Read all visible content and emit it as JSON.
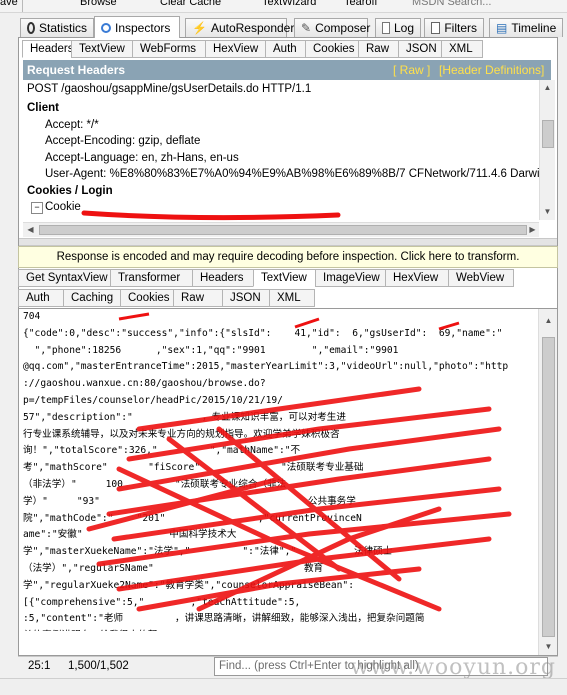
{
  "toolbar_top": {
    "items": [
      "ave",
      "Browse",
      "Clear Cache",
      "TextWizard",
      "Tearoff",
      "MSDN Search..."
    ]
  },
  "main_tabs": [
    {
      "label": "Statistics",
      "icon": "stopwatch-icon"
    },
    {
      "label": "Inspectors",
      "icon": "magnifier-icon",
      "active": true
    },
    {
      "label": "AutoResponder",
      "icon": "lightning-icon"
    },
    {
      "label": "Composer",
      "icon": "pencil-icon"
    },
    {
      "label": "Log",
      "icon": "log-icon"
    },
    {
      "label": "Filters",
      "icon": "checkbox-icon"
    },
    {
      "label": "Timeline",
      "icon": "timeline-icon"
    }
  ],
  "request_tabs": [
    "Headers",
    "TextView",
    "WebForms",
    "HexView",
    "Auth",
    "Cookies",
    "Raw",
    "JSON",
    "XML"
  ],
  "request_headers": {
    "title": "Request Headers",
    "raw_link": "[ Raw ]",
    "defs_link": "[Header Definitions]",
    "request_line": "POST /gaoshou/gsappMine/gsUserDetails.do HTTP/1.1",
    "groups": [
      {
        "name": "Client",
        "lines": [
          "Accept: */*",
          "Accept-Encoding: gzip, deflate",
          "Accept-Language: en, zh-Hans, en-us",
          "User-Agent: %E8%80%83%E7%A0%94%E9%AB%98%E6%89%8B/7 CFNetwork/711.4.6 Darwin/1"
        ]
      },
      {
        "name": "Cookies / Login",
        "lines": [
          "Cookie"
        ]
      }
    ]
  },
  "banner": "Response is encoded and may require decoding before inspection. Click here to transform.",
  "response_tabs_row1": [
    "Get SyntaxView",
    "Transformer",
    "Headers",
    "TextView",
    "ImageView",
    "HexView",
    "WebView"
  ],
  "response_tabs_row2": [
    "Auth",
    "Caching",
    "Cookies",
    "Raw",
    "JSON",
    "XML"
  ],
  "response_text": [
    "704",
    "{\"code\":0,\"desc\":\"success\",\"info\":{\"slsId\":    41,\"id\":  6,\"gsUserId\":  69,\"name\":\"",
    "  \",\"phone\":18256      ,\"sex\":1,\"qq\":\"9901        \",\"email\":\"9901",
    "@qq.com\",\"masterEntranceTime\":2015,\"masterYearLimit\":3,\"videoUrl\":null,\"photo\":\"http",
    "://gaoshou.wanxue.cn:80/gaoshou/browse.do?",
    "p=/tempFiles/counselor/headPic/2015/10/21/19/",
    "57\",\"description\":\"            ，专业课知识丰富，可以对考生进",
    "行专业课系统辅导，以及对未来专业方向的规划指导。欢迎学弟学妹积极咨",
    "询！\",\"totalScore\":326,\"         \",\"mathName\":\"不",
    "考\",\"mathScore\"       \"fiScore\"              \"法硕联考专业基础",
    "（非法学）\"     100         \"法硕联考专业综合（非法",
    "学）\"     \"93\"                                    公共事务学",
    "院\",\"mathCode\":\"    \"201\"                ,\"currentProvinceN",
    "ame\":\"安徽\"               中国科学技术大",
    "学\",\"masterXuekeName\":\"法学\",\"         \":\"法律\",\"          法律硕士",
    "（法学）\",\"regularSName\"                          教育",
    "学\",\"regularXueke2Name\":\"教育学类\",\"counselorAppraiseBean\":",
    "[{\"comprehensive\":5,\"        ,\"teachAttitude\":5,",
    ":5,\"content\":\"老师         ，讲课思路清晰，讲解细致，能够深入浅出，把复杂问题简",
    "单的事例讲明白，给我很大的帮",
    "助。\",\"valuatorId\":2472,\"valuatorName\":\"          \",\"beEvaluatorId\":8",
    "69,\"beEvaluatorName\":\"    ",
    "  \",\"appraiseTime\":1445568529000}],\"appraiseNum\":1,\"comprehensive\":5.0000,\"descConfor"
  ],
  "status": {
    "position": "25:1",
    "lines": "1,500/1,502",
    "find_placeholder": "Find... (press Ctrl+Enter to highlight all)",
    "watermark": "www.wooyun.org"
  },
  "colors": {
    "header_bar": "#8aa3b4",
    "header_links": "#ffe04a",
    "banner_bg": "#ffffe1",
    "redaction": "#ee1111"
  }
}
